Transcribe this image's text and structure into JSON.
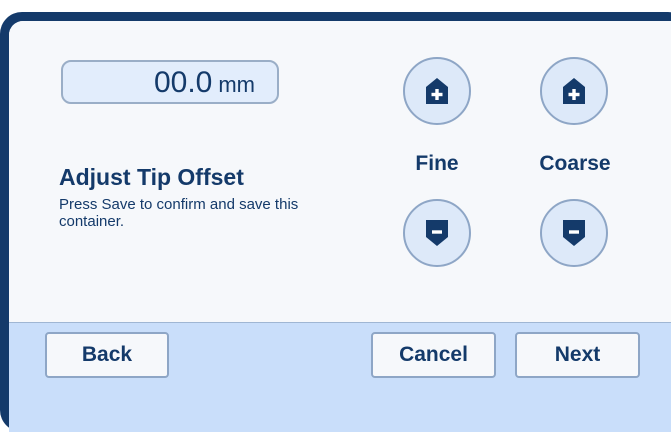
{
  "tip_offset": {
    "value": "00.0",
    "unit": "mm"
  },
  "instructions": {
    "title": "Adjust Tip Offset",
    "text": "Press Save to confirm and save this container."
  },
  "controls": {
    "fine_label": "Fine",
    "coarse_label": "Coarse",
    "increase_icon": "plus-arrow-up-icon",
    "decrease_icon": "minus-arrow-down-icon"
  },
  "footer": {
    "back_label": "Back",
    "cancel_label": "Cancel",
    "next_label": "Next"
  },
  "colors": {
    "frame": "#143a6a",
    "screen_background": "#f6f8fb",
    "footer_background": "#c9defa",
    "button_fill": "#dde9f9",
    "accent_text": "#143a6a"
  }
}
